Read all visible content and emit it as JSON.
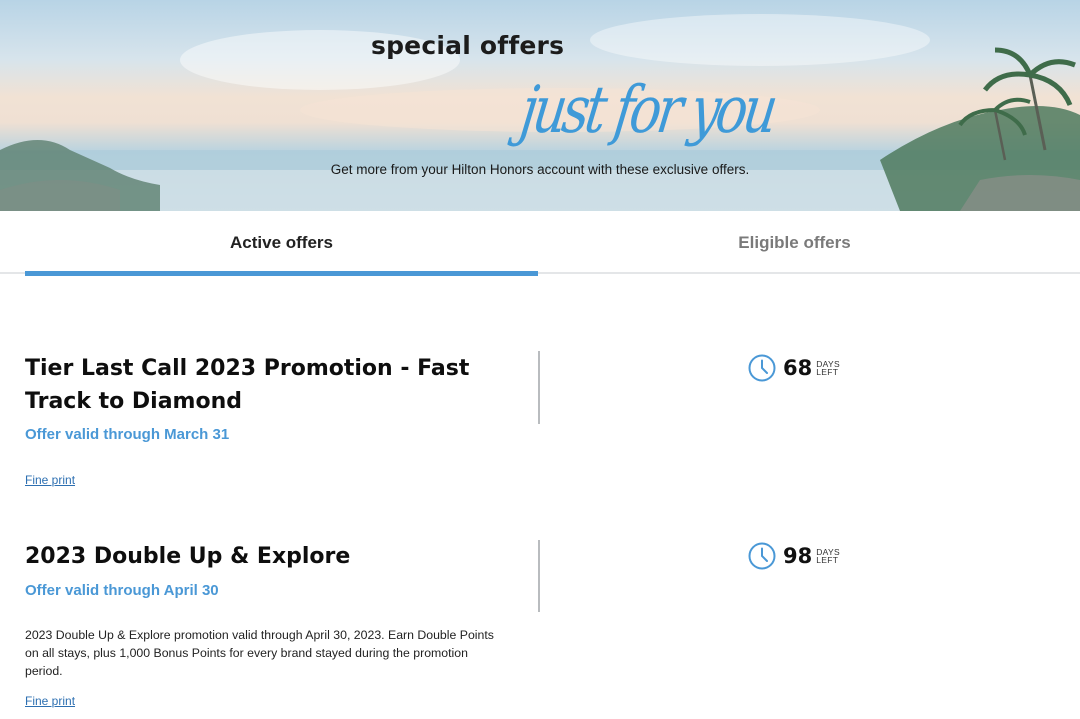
{
  "hero": {
    "title": "special offers",
    "script_text": "just for you",
    "subtitle": "Get more from your Hilton Honors account with these exclusive offers."
  },
  "tabs": [
    {
      "label": "Active offers",
      "selected": true
    },
    {
      "label": "Eligible offers",
      "selected": false
    }
  ],
  "offers": [
    {
      "title": "Tier Last Call 2023 Promotion - Fast Track to Diamond",
      "valid": "Offer valid through March 31",
      "description": "",
      "fine_print": "Fine print",
      "days": "68",
      "days_label_1": "DAYS",
      "days_label_2": "LEFT"
    },
    {
      "title": "2023 Double Up & Explore",
      "valid": "Offer valid through April 30",
      "description": "2023 Double Up & Explore promotion valid through April 30, 2023. Earn Double Points on all stays, plus 1,000 Bonus Points for every brand stayed during the promotion period.",
      "fine_print": "Fine print",
      "days": "98",
      "days_label_1": "DAYS",
      "days_label_2": "LEFT"
    }
  ],
  "colors": {
    "accent": "#4a98d6",
    "link": "#2d6fb1"
  },
  "icons": {
    "countdown": "clock-icon"
  }
}
